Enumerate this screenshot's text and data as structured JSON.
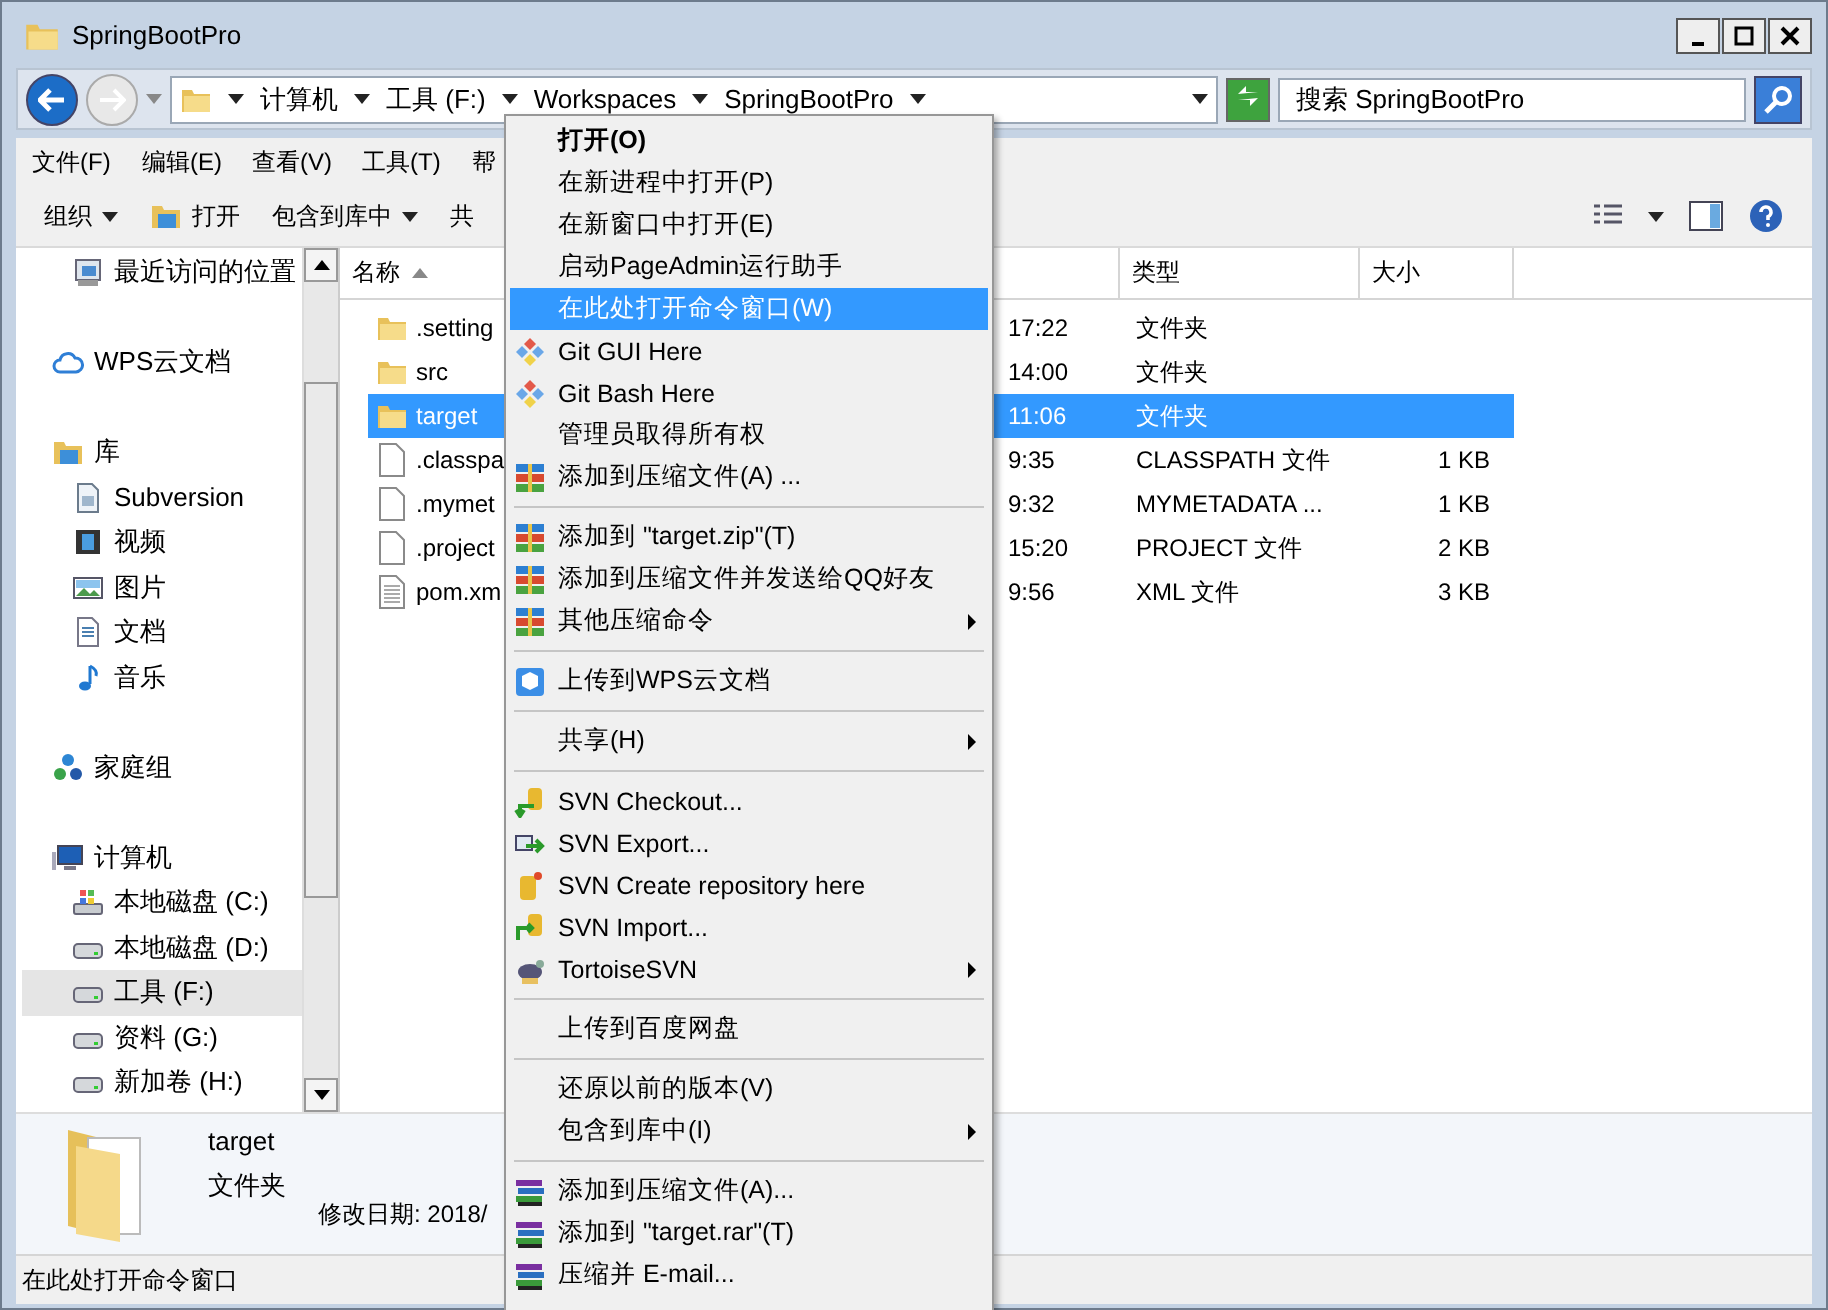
{
  "window": {
    "title": "SpringBootPro"
  },
  "address_bar": {
    "crumbs": [
      "计算机",
      "工具 (F:)",
      "Workspaces",
      "SpringBootPro"
    ]
  },
  "search": {
    "placeholder": "搜索 SpringBootPro"
  },
  "menu_bar": [
    "文件(F)",
    "编辑(E)",
    "查看(V)",
    "工具(T)",
    "帮"
  ],
  "toolbar": [
    {
      "label": "组织",
      "kind": "dropdown"
    },
    {
      "label": "打开",
      "kind": "open"
    },
    {
      "label": "包含到库中",
      "kind": "dropdown"
    },
    {
      "label": "共",
      "kind": "plain"
    }
  ],
  "sidebar": {
    "sections": [
      {
        "children": [
          {
            "label": "最近访问的位置",
            "kind": "recent",
            "selected": false
          }
        ]
      },
      {
        "label": "WPS云文档",
        "kind": "cloud",
        "selected": false
      },
      {
        "label": "库",
        "kind": "library",
        "selected": false,
        "children": [
          {
            "label": "Subversion",
            "kind": "svn",
            "selected": false
          },
          {
            "label": "视频",
            "kind": "video",
            "selected": false
          },
          {
            "label": "图片",
            "kind": "pictures",
            "selected": false
          },
          {
            "label": "文档",
            "kind": "documents",
            "selected": false
          },
          {
            "label": "音乐",
            "kind": "music",
            "selected": false
          }
        ]
      },
      {
        "label": "家庭组",
        "kind": "homegroup",
        "selected": false
      },
      {
        "label": "计算机",
        "kind": "computer",
        "selected": false,
        "children": [
          {
            "label": "本地磁盘 (C:)",
            "kind": "system-drive",
            "selected": false
          },
          {
            "label": "本地磁盘 (D:)",
            "kind": "drive",
            "selected": false
          },
          {
            "label": "工具 (F:)",
            "kind": "drive",
            "selected": true
          },
          {
            "label": "资料 (G:)",
            "kind": "drive",
            "selected": false
          },
          {
            "label": "新加卷 (H:)",
            "kind": "drive",
            "selected": false
          }
        ]
      }
    ]
  },
  "table": {
    "columns": [
      "名称",
      "类型",
      "大小"
    ],
    "rows": [
      {
        "name": ".setting",
        "time": "17:22",
        "type": "文件夹",
        "size": "",
        "kind": "folder",
        "selected": false
      },
      {
        "name": "src",
        "time": "14:00",
        "type": "文件夹",
        "size": "",
        "kind": "folder",
        "selected": false
      },
      {
        "name": "target",
        "time": "11:06",
        "type": "文件夹",
        "size": "",
        "kind": "folder",
        "selected": true
      },
      {
        "name": ".classpa",
        "time": "9:35",
        "type": "CLASSPATH 文件",
        "size": "1 KB",
        "kind": "file",
        "selected": false
      },
      {
        "name": ".mymet",
        "time": "9:32",
        "type": "MYMETADATA ...",
        "size": "1 KB",
        "kind": "file",
        "selected": false
      },
      {
        "name": ".project",
        "time": "15:20",
        "type": "PROJECT 文件",
        "size": "2 KB",
        "kind": "file",
        "selected": false
      },
      {
        "name": "pom.xm",
        "time": "9:56",
        "type": "XML 文件",
        "size": "3 KB",
        "kind": "text",
        "selected": false
      }
    ]
  },
  "details": {
    "name": "target",
    "type": "文件夹",
    "modified": "修改日期: 2018/"
  },
  "status_bar": "在此处打开命令窗口",
  "context_menu": [
    {
      "kind": "plain",
      "label": "打开(O)",
      "bold": true,
      "selected": false
    },
    {
      "kind": "plain",
      "label": "在新进程中打开(P)",
      "selected": false
    },
    {
      "kind": "plain",
      "label": "在新窗口中打开(E)",
      "selected": false
    },
    {
      "kind": "plain",
      "label": "启动PageAdmin运行助手",
      "selected": false
    },
    {
      "kind": "plain",
      "label": "在此处打开命令窗口(W)",
      "selected": true
    },
    {
      "kind": "git",
      "label": "Git GUI Here",
      "selected": false
    },
    {
      "kind": "git",
      "label": "Git Bash Here",
      "selected": false
    },
    {
      "kind": "plain",
      "label": "管理员取得所有权",
      "selected": false
    },
    {
      "kind": "winrar",
      "label": "添加到压缩文件(A) ...",
      "selected": false
    },
    {
      "kind": "separator"
    },
    {
      "kind": "winrar",
      "label": "添加到 \"target.zip\"(T)",
      "selected": false
    },
    {
      "kind": "winrar",
      "label": "添加到压缩文件并发送给QQ好友",
      "selected": false
    },
    {
      "kind": "winrar",
      "label": "其他压缩命令",
      "submenu": true,
      "selected": false
    },
    {
      "kind": "separator"
    },
    {
      "kind": "wps",
      "label": "上传到WPS云文档",
      "selected": false
    },
    {
      "kind": "separator"
    },
    {
      "kind": "plain",
      "label": "共享(H)",
      "submenu": true,
      "selected": false
    },
    {
      "kind": "separator"
    },
    {
      "kind": "svn-checkout",
      "label": "SVN Checkout...",
      "selected": false
    },
    {
      "kind": "svn-export",
      "label": "SVN Export...",
      "selected": false
    },
    {
      "kind": "svn-create",
      "label": "SVN Create repository here",
      "selected": false
    },
    {
      "kind": "svn-import",
      "label": "SVN Import...",
      "selected": false
    },
    {
      "kind": "tortoise",
      "label": "TortoiseSVN",
      "submenu": true,
      "selected": false
    },
    {
      "kind": "separator"
    },
    {
      "kind": "plain",
      "label": "上传到百度网盘",
      "selected": false
    },
    {
      "kind": "separator"
    },
    {
      "kind": "plain",
      "label": "还原以前的版本(V)",
      "selected": false
    },
    {
      "kind": "plain",
      "label": "包含到库中(I)",
      "submenu": true,
      "selected": false
    },
    {
      "kind": "separator"
    },
    {
      "kind": "rar",
      "label": "添加到压缩文件(A)...",
      "selected": false
    },
    {
      "kind": "rar",
      "label": "添加到 \"target.rar\"(T)",
      "selected": false
    },
    {
      "kind": "rar",
      "label": "压缩并 E-mail...",
      "selected": false
    }
  ]
}
